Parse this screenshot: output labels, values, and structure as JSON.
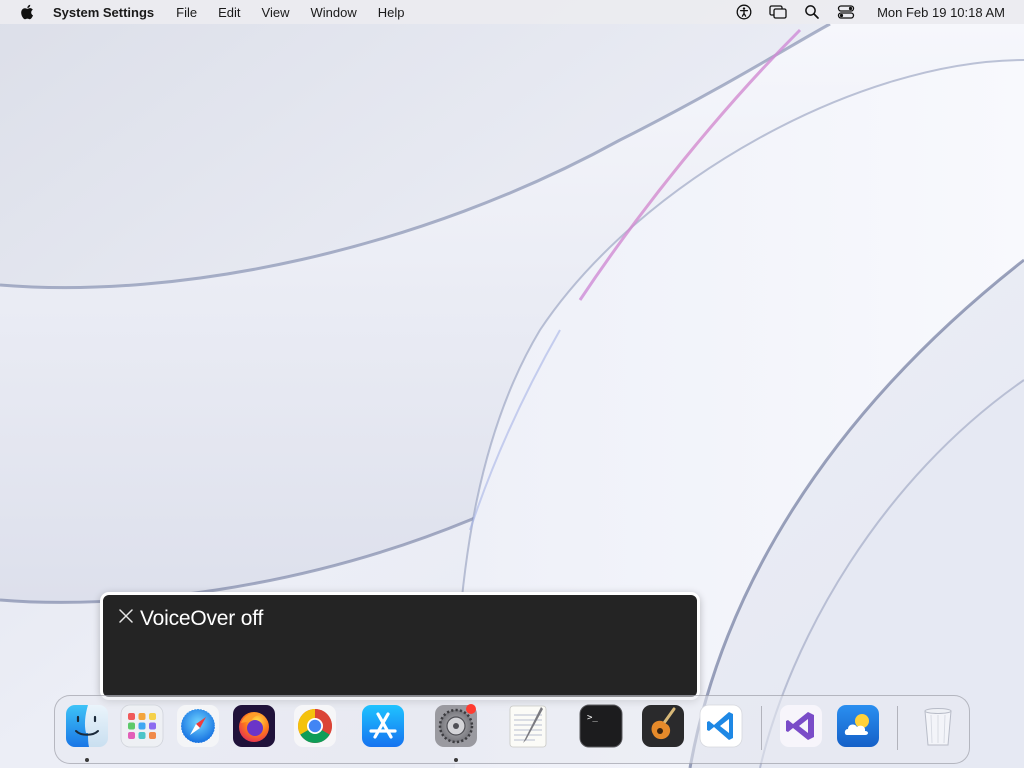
{
  "menubar": {
    "app_name": "System Settings",
    "menus": [
      "File",
      "Edit",
      "View",
      "Window",
      "Help"
    ],
    "status_icons": [
      "accessibility-icon",
      "screen-mirroring-icon",
      "spotlight-search-icon",
      "control-center-icon"
    ],
    "clock": "Mon Feb 19  10:18 AM"
  },
  "voiceover_panel": {
    "text": "VoiceOver off"
  },
  "dock": {
    "apps": [
      {
        "name": "Finder",
        "icon": "finder-icon",
        "running": true
      },
      {
        "name": "Launchpad",
        "icon": "launchpad-icon",
        "running": false
      },
      {
        "name": "Safari",
        "icon": "safari-icon",
        "running": false
      },
      {
        "name": "Firefox",
        "icon": "firefox-icon",
        "running": false
      },
      {
        "name": "Google Chrome",
        "icon": "chrome-icon",
        "running": false
      },
      {
        "name": "App Store",
        "icon": "app-store-icon",
        "running": false
      },
      {
        "name": "System Settings",
        "icon": "system-settings-icon",
        "running": true
      },
      {
        "name": "TextEdit",
        "icon": "textedit-icon",
        "running": false
      },
      {
        "name": "Terminal",
        "icon": "terminal-icon",
        "running": false
      },
      {
        "name": "GarageBand",
        "icon": "garageband-icon",
        "running": false
      },
      {
        "name": "Visual Studio Code",
        "icon": "vscode-icon",
        "running": false
      },
      {
        "name": "Visual Studio",
        "icon": "visual-studio-icon",
        "running": false
      },
      {
        "name": "Weather",
        "icon": "weather-icon",
        "running": false
      },
      {
        "name": "Trash",
        "icon": "trash-icon",
        "running": false
      }
    ],
    "terminal_prompt": ">_"
  },
  "colors": {
    "menubar_bg": "#ececf0",
    "panel_bg": "#242424",
    "panel_border": "#ffffff",
    "wallpaper_base": "#e9ebf4"
  }
}
